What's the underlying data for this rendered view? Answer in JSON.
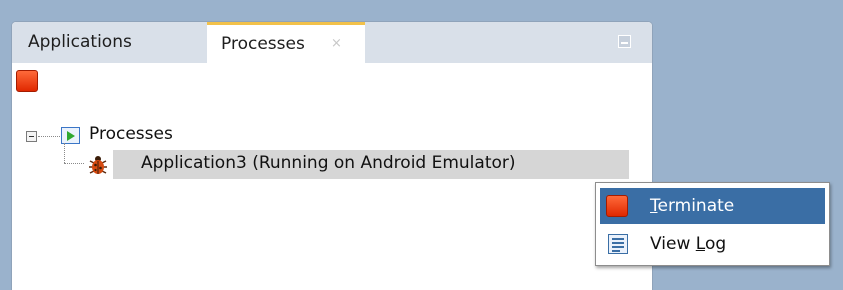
{
  "tabs": {
    "applications": "Applications",
    "processes": "Processes",
    "close_glyph": "×"
  },
  "toolbar": {
    "stop_icon": "stop-icon"
  },
  "tree": {
    "root_label": "Processes",
    "app_label": "Application3 (Running on Android Emulator)"
  },
  "menu": {
    "terminate": {
      "label_mnemonic": "T",
      "label_rest": "erminate"
    },
    "view_log": {
      "label_prefix": "View ",
      "label_mnemonic": "L",
      "label_rest": "og"
    }
  },
  "colors": {
    "background": "#9ab2cc",
    "tab_accent": "#f2c14a",
    "selection": "#3a6ea5",
    "stop_red": "#e02800"
  }
}
